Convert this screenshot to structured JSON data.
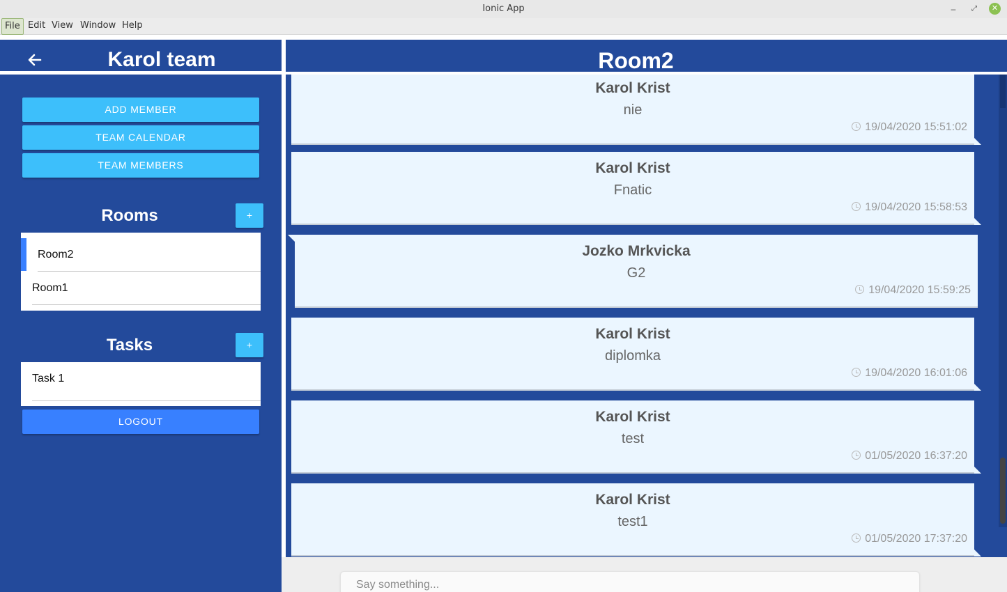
{
  "window": {
    "title": "Ionic App"
  },
  "menubar": [
    "File",
    "Edit",
    "View",
    "Window",
    "Help"
  ],
  "sidebar": {
    "team_title": "Karol team",
    "buttons": {
      "add_member": "ADD MEMBER",
      "team_calendar": "TEAM CALENDAR",
      "team_members": "TEAM MEMBERS",
      "logout": "LOGOUT"
    },
    "rooms_title": "Rooms",
    "rooms": [
      "Room2",
      "Room1"
    ],
    "selected_room": "Room2",
    "tasks_title": "Tasks",
    "tasks": [
      "Task 1"
    ],
    "plus_label": "+"
  },
  "main": {
    "room_title": "Room2",
    "messages": [
      {
        "author": "Karol Krist",
        "text": "nie",
        "time": "19/04/2020 15:51:02",
        "side": "right"
      },
      {
        "author": "Karol Krist",
        "text": "Fnatic",
        "time": "19/04/2020 15:58:53",
        "side": "right"
      },
      {
        "author": "Jozko Mrkvicka",
        "text": "G2",
        "time": "19/04/2020 15:59:25",
        "side": "left"
      },
      {
        "author": "Karol Krist",
        "text": "diplomka",
        "time": "19/04/2020 16:01:06",
        "side": "right"
      },
      {
        "author": "Karol Krist",
        "text": "test",
        "time": "01/05/2020 16:37:20",
        "side": "right"
      },
      {
        "author": "Karol Krist",
        "text": "test1",
        "time": "01/05/2020 17:37:20",
        "side": "right"
      }
    ],
    "input_placeholder": "Say something..."
  },
  "colors": {
    "primary_dark": "#234a9b",
    "secondary": "#3dbffb",
    "primary": "#3880ff",
    "message_bg": "#ebf6ff"
  }
}
